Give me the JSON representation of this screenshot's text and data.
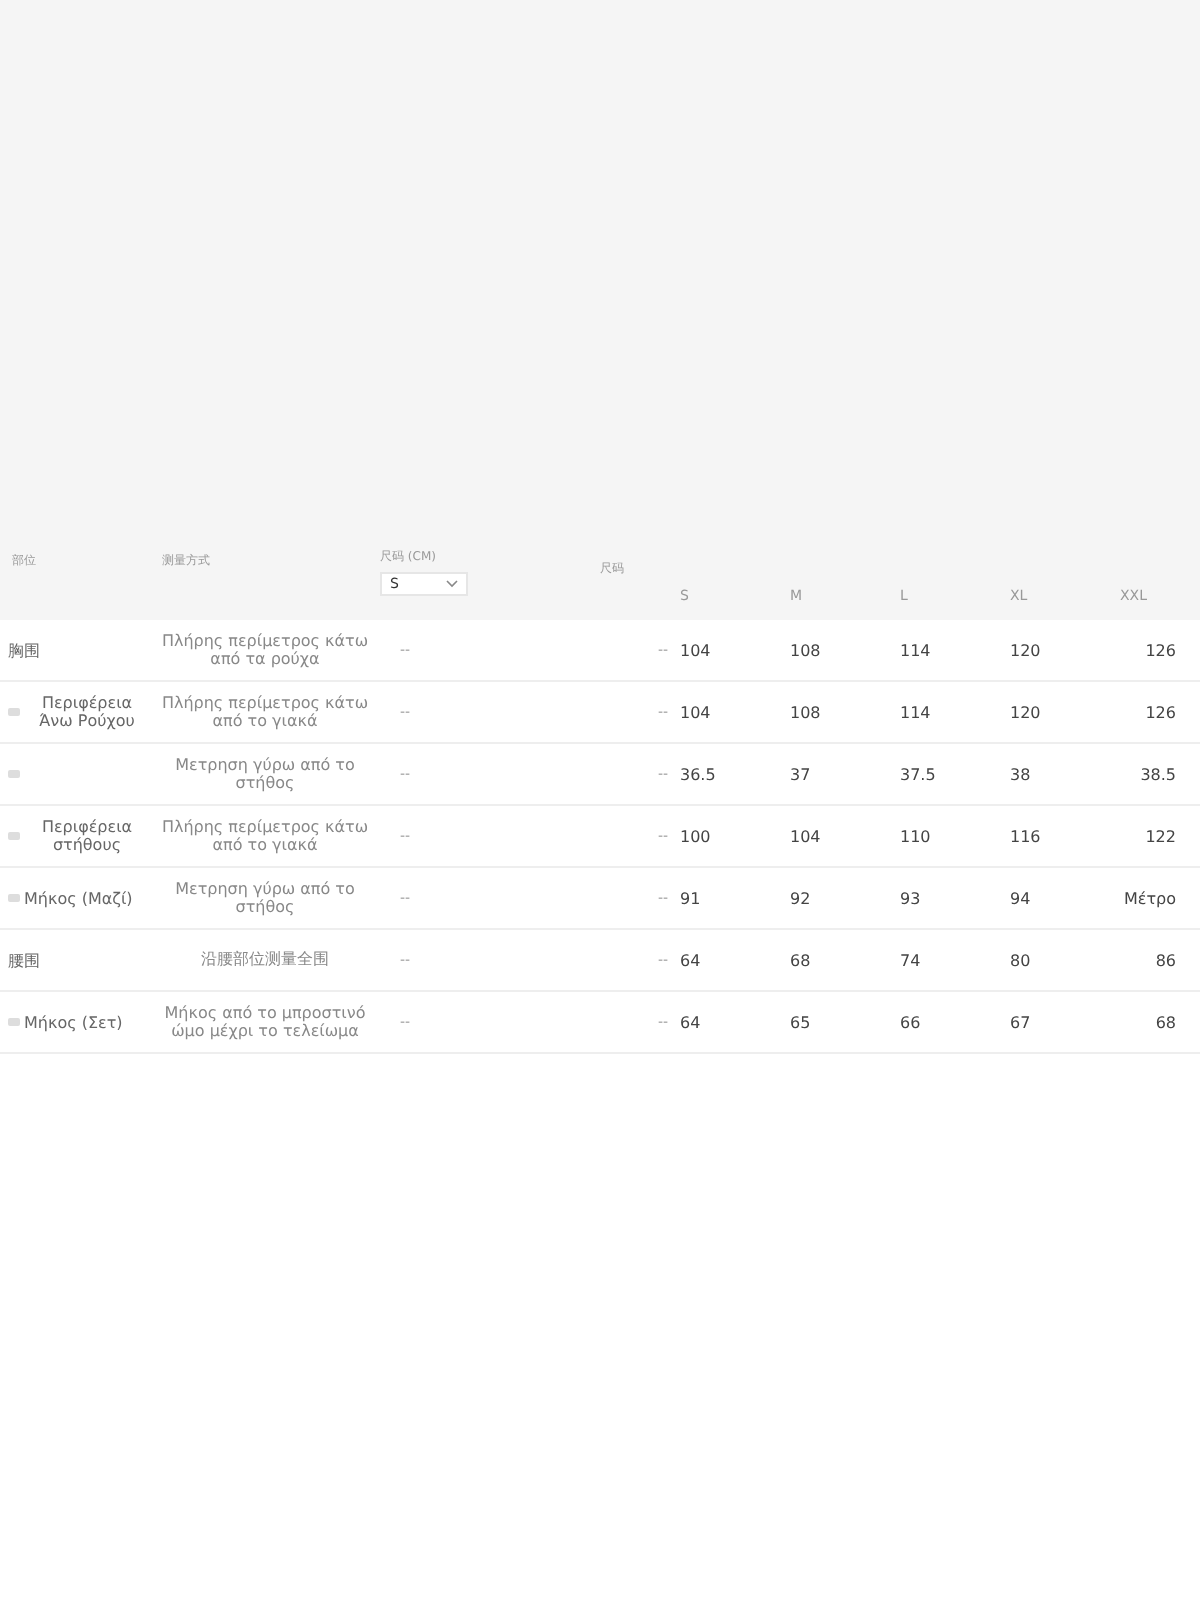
{
  "table": {
    "columns": [
      "部位",
      "测量方式"
    ],
    "size_picker": {
      "label": "尺码 (CM)",
      "value": "S"
    },
    "column_4": "尺码",
    "sizes": [
      "S",
      "M",
      "L",
      "XL",
      "XXL"
    ],
    "rows": [
      {
        "name": "胸围",
        "icon": false,
        "description": "Πλήρης περίμετρος κάτω από τα ρούχα",
        "column_3": "--",
        "column_4": "--",
        "values": [
          "104",
          "108",
          "114",
          "120",
          "126"
        ]
      },
      {
        "name": "Περιφέρεια Άνω Ρούχου",
        "icon": true,
        "description": "Πλήρης περίμετρος κάτω από το γιακά",
        "column_3": "--",
        "column_4": "--",
        "values": [
          "104",
          "108",
          "114",
          "120",
          "126"
        ]
      },
      {
        "icon": true,
        "description": "Μετρηση γύρω από το στήθος",
        "column_3": "--",
        "column_4": "--",
        "values": [
          "36.5",
          "37",
          "37.5",
          "38",
          "38.5"
        ]
      },
      {
        "name": "Περιφέρεια στήθους",
        "icon": true,
        "description": "Πλήρης περίμετρος κάτω από το γιακά",
        "column_3": "--",
        "column_4": "--",
        "values": [
          "100",
          "104",
          "110",
          "116",
          "122"
        ]
      },
      {
        "name": "Μήκος (Μαζί)",
        "icon": true,
        "description": "Μετρηση γύρω από το στήθος",
        "column_3": "--",
        "column_4": "--",
        "values": [
          "91",
          "92",
          "93",
          "94",
          "Μέτρο"
        ]
      },
      {
        "name": "腰围",
        "icon": false,
        "description": "沿腰部位测量全围",
        "column_3": "--",
        "column_4": "--",
        "values": [
          "64",
          "68",
          "74",
          "80",
          "86"
        ]
      },
      {
        "name": "Μήκος (Σετ)",
        "icon": true,
        "description": "Μήκος από το μπροστινό ώμο μέχρι το τελείωμα",
        "column_3": "--",
        "column_4": "--",
        "values": [
          "64",
          "65",
          "66",
          "67",
          "68"
        ]
      }
    ]
  }
}
